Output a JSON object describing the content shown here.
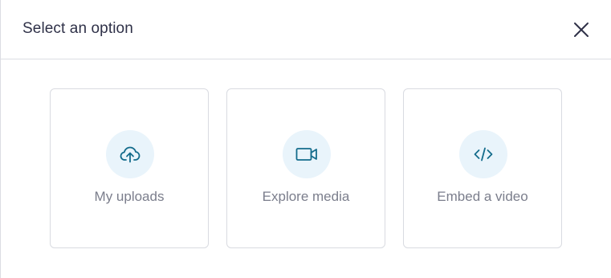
{
  "dialog": {
    "title": "Select an option",
    "close_icon": "close-icon"
  },
  "options": [
    {
      "label": "My uploads",
      "icon": "cloud-upload-icon"
    },
    {
      "label": "Explore media",
      "icon": "video-camera-icon"
    },
    {
      "label": "Embed a video",
      "icon": "code-icon"
    }
  ],
  "colors": {
    "title_text": "#2f3148",
    "label_text": "#7b7e8c",
    "icon_accent": "#146c8c",
    "icon_background": "#e9f4fb",
    "border": "#dcdde3"
  }
}
